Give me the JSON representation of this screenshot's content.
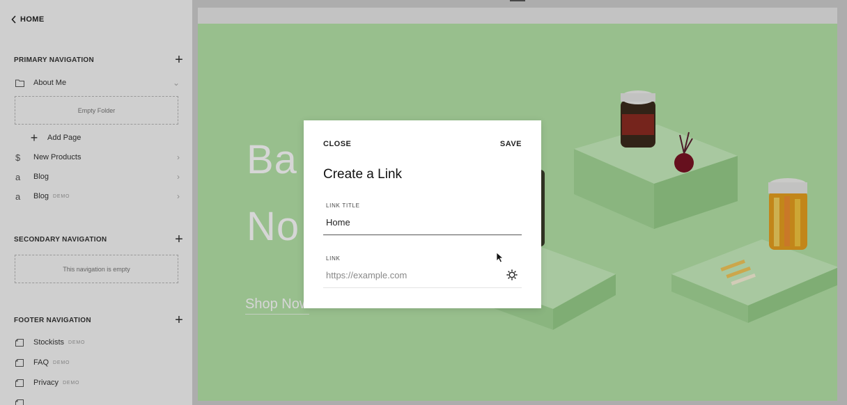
{
  "sidebar": {
    "back_label": "HOME",
    "primary": {
      "title": "PRIMARY NAVIGATION",
      "items": [
        {
          "icon": "folder-icon",
          "label": "About Me",
          "demo": "",
          "chev": "⌄"
        },
        {
          "icon": "dollar-icon",
          "label": "New Products",
          "demo": "",
          "chev": "›"
        },
        {
          "icon": "blog-icon",
          "label": "Blog",
          "demo": "",
          "chev": "›"
        },
        {
          "icon": "blog-icon",
          "label": "Blog",
          "demo": "DEMO",
          "chev": "›"
        }
      ],
      "empty_folder": "Empty Folder",
      "add_page": "Add Page"
    },
    "secondary": {
      "title": "SECONDARY NAVIGATION",
      "empty": "This navigation is empty"
    },
    "footer": {
      "title": "FOOTER NAVIGATION",
      "items": [
        {
          "icon": "page-icon",
          "label": "Stockists",
          "demo": "DEMO"
        },
        {
          "icon": "page-icon",
          "label": "FAQ",
          "demo": "DEMO"
        },
        {
          "icon": "page-icon",
          "label": "Privacy",
          "demo": "DEMO"
        }
      ]
    }
  },
  "preview": {
    "hero_line1": "Ba",
    "hero_line2": "No",
    "cta": "Shop Now",
    "background_color": "#b5e4a9"
  },
  "modal": {
    "close_label": "CLOSE",
    "save_label": "SAVE",
    "title": "Create a Link",
    "link_title_label": "LINK TITLE",
    "link_title_value": "Home",
    "link_label": "LINK",
    "link_placeholder": "https://example.com",
    "settings_icon": "gear-icon"
  },
  "colors": {
    "sidebar_bg": "#f7f7f7",
    "preview_bg": "#b5e4a9",
    "modal_bg": "#ffffff"
  }
}
